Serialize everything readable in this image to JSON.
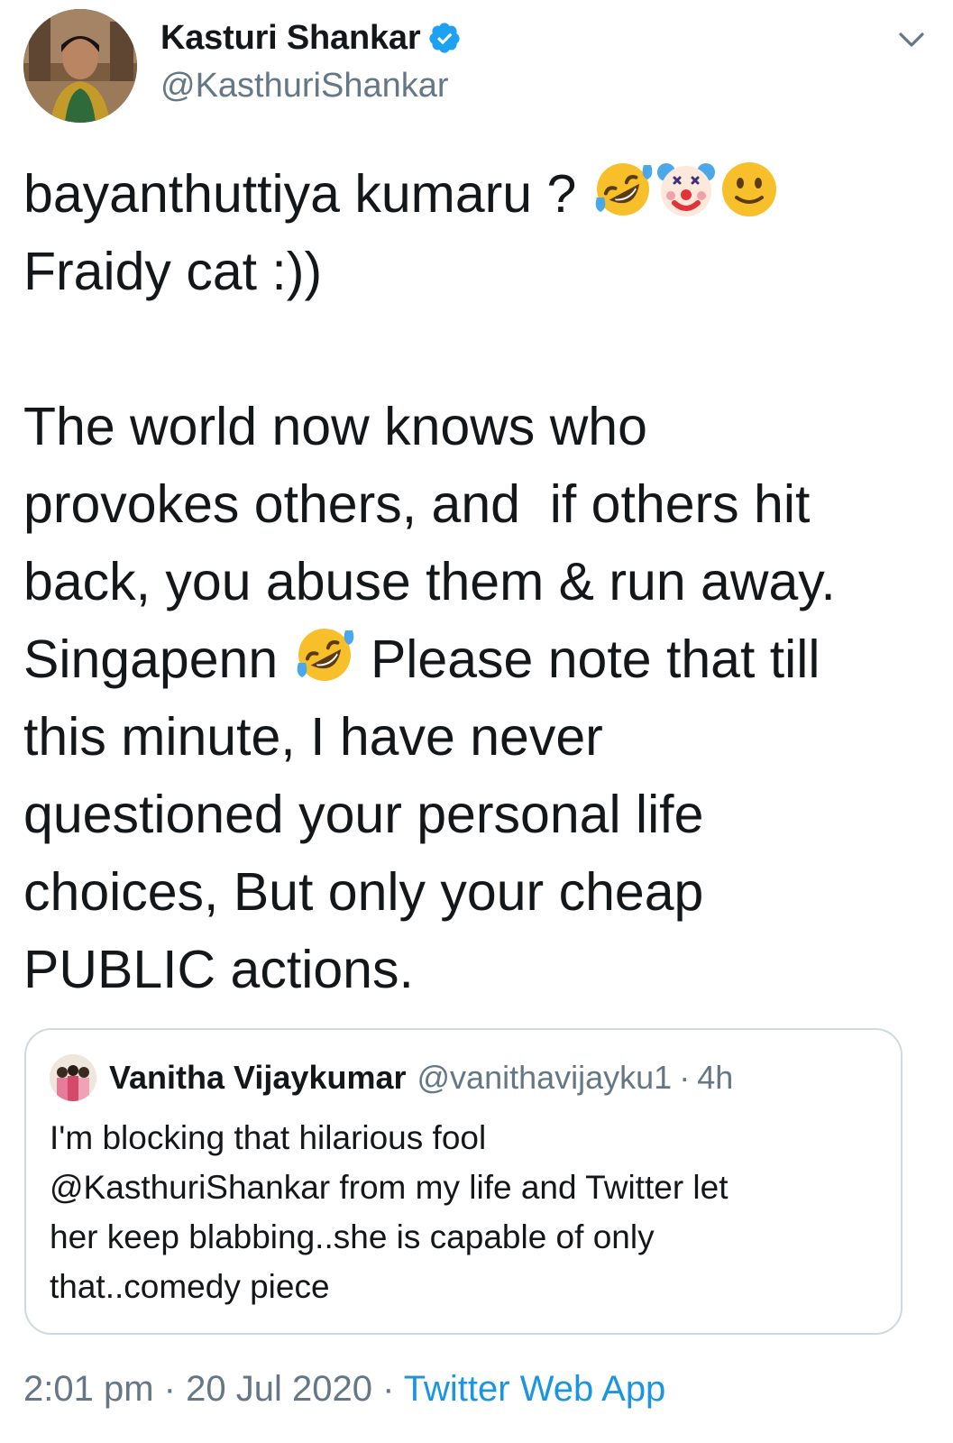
{
  "tweet": {
    "author": {
      "display_name": "Kasturi Shankar",
      "handle": "@KasthuriShankar",
      "verified": true,
      "avatar_icon": "profile-photo"
    },
    "menu_icon": "chevron-down-icon",
    "text_lines": [
      "bayanthuttiya kumaru ? ",
      "Fraidy cat :))",
      "",
      "The world now knows who",
      "provokes others, and  if others hit",
      "back, you abuse them & run away.",
      "Singapenn ",
      " Please note that till",
      "this minute, I have never",
      "questioned your personal life",
      "choices, But only your cheap",
      "PUBLIC actions."
    ],
    "emojis": [
      "rolling-on-floor-laughing",
      "clown-face",
      "slightly-smiling-face",
      "rolling-on-floor-laughing"
    ]
  },
  "quoted_tweet": {
    "display_name": "Vanitha Vijaykumar",
    "handle": "@vanithavijayku1",
    "separator": "·",
    "time": "4h",
    "text": "I'm blocking that hilarious fool\n@KasthuriShankar from my life and Twitter let\nher keep blabbing..she is capable of only\nthat..comedy piece"
  },
  "meta": {
    "time": "2:01 pm",
    "separator": "·",
    "date": "20 Jul 2020",
    "source": "Twitter Web App"
  },
  "colors": {
    "text": "#14171a",
    "secondary": "#657786",
    "link": "#1b95e0",
    "verified": "#1da1f2",
    "border": "#cfd9de"
  }
}
